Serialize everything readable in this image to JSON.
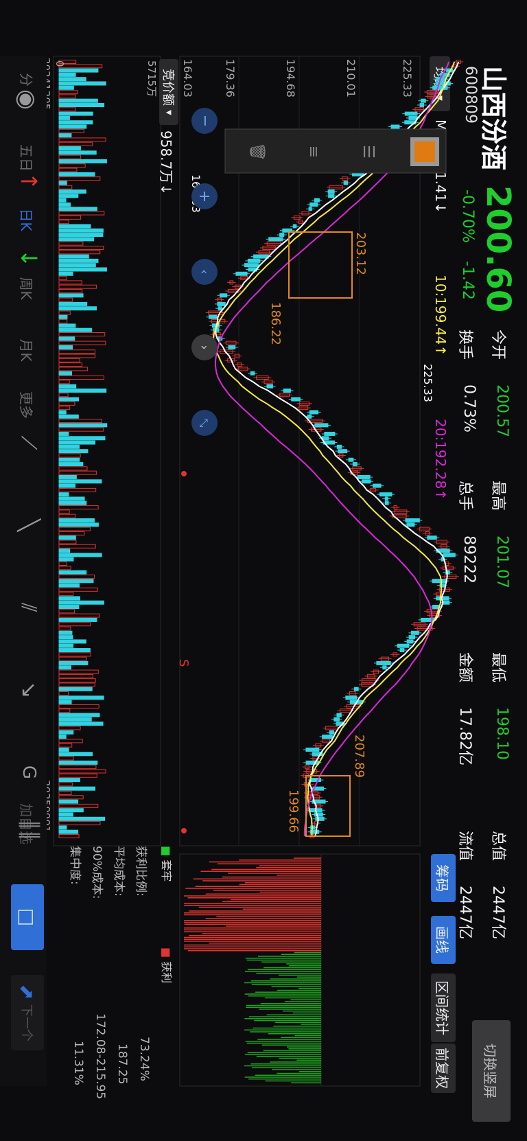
{
  "stock": {
    "name": "山西汾酒",
    "code": "600809",
    "price": "200.60",
    "change_pct": "-0.70%",
    "change_abs": "-1.42"
  },
  "stats": {
    "open_label": "今开",
    "open_value": "200.57",
    "high_label": "最高",
    "high_value": "201.07",
    "low_label": "最低",
    "low_value": "198.10",
    "totalcap_label": "总值",
    "totalcap_value": "2447亿",
    "turnover_label": "换手",
    "turnover_value": "0.73%",
    "volume_label": "总手",
    "volume_value": "89222",
    "amount_label": "金额",
    "amount_value": "17.82亿",
    "floatcap_label": "流值",
    "floatcap_value": "2447亿"
  },
  "top_buttons": {
    "switch_portrait": "切换竖屏",
    "chips": "筹码",
    "draw_line": "画线",
    "interval_stats": "区间统计",
    "adjust": "前复权"
  },
  "ma_bar": {
    "selector": "均线",
    "ma5": "MA5:201.41↓",
    "ma10": "10:199.44↑",
    "ma20": "20:192.28↑"
  },
  "price_axis": {
    "high": "225.33",
    "l2": "210.01",
    "l3": "194.68",
    "l4": "179.36",
    "low": "164.03"
  },
  "chart_annotations": {
    "max_price": "225.33",
    "min_price": "164.03",
    "box1_top": "203.12",
    "box1_bottom": "186.22",
    "box2_top": "207.89",
    "box2_bottom": "199.66",
    "signal_s": "S"
  },
  "volume_bar": {
    "selector": "竞价额",
    "value": "958.7万↓",
    "axis_top": "5715万",
    "axis_zero": "0"
  },
  "dates": {
    "start": "20241205",
    "end": "20250901"
  },
  "chip_panel": {
    "legend_trapped": "套牢",
    "legend_profit": "获利",
    "profit_ratio_label": "获利比例:",
    "profit_ratio_value": "73.24%",
    "avg_cost_label": "平均成本:",
    "avg_cost_value": "187.25",
    "cost90_label": "90%成本:",
    "cost90_value": "172.08-215.95",
    "concentration_label": "集中度:",
    "concentration_value": "11.31%"
  },
  "toolbar": {
    "items": [
      "分",
      "五日",
      "日K",
      "周K",
      "月K",
      "更多"
    ],
    "add_watch": "加自选",
    "next": "下一个"
  },
  "colors": {
    "up": "#e0342f",
    "down": "#32d2e0",
    "ma5": "#ffffff",
    "ma10": "#f5ea4a",
    "ma20": "#d82ad8",
    "accent": "#2f6fd6"
  }
}
